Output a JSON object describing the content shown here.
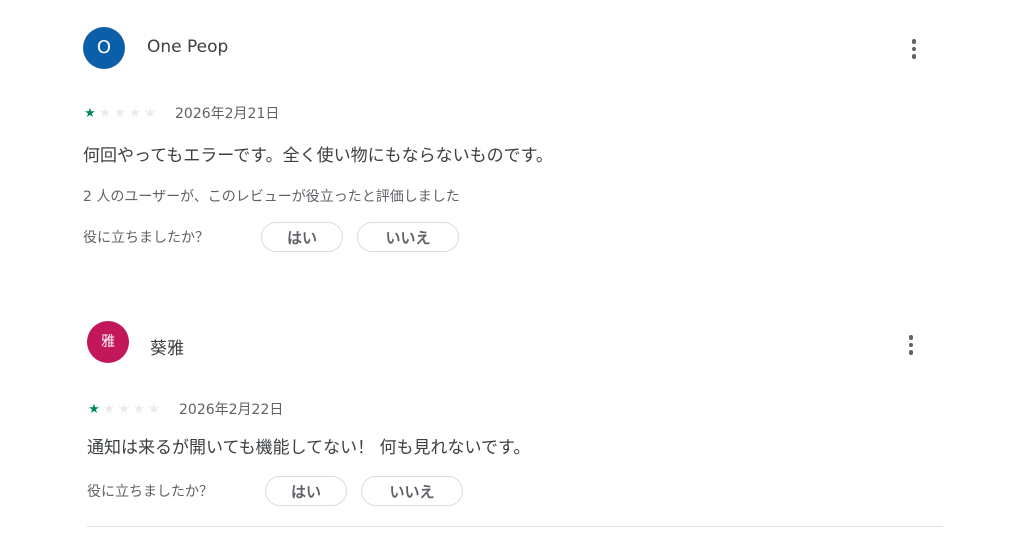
{
  "reviews": [
    {
      "avatar_letter": "O",
      "avatar_color": "#0b5ea8",
      "author": "One Peop",
      "rating": 1,
      "max_rating": 5,
      "date": "2026年2月21日",
      "text": "何回やってもエラーです。全く使い物にもならないものです。",
      "helpful_count": "2 人のユーザーが、このレビューが役立ったと評価しました",
      "helpful_question": "役に立ちましたか？",
      "yes_label": "はい",
      "no_label": "いいえ",
      "more_icon": "more-vert-icon"
    },
    {
      "avatar_letter": "雅",
      "avatar_color": "#c2185b",
      "author": "葵雅",
      "rating": 1,
      "max_rating": 5,
      "date": "2026年2月22日",
      "text": "通知は来るが開いても機能してない！ 何も見れないです。",
      "helpful_question": "役に立ちましたか？",
      "yes_label": "はい",
      "no_label": "いいえ",
      "more_icon": "more-vert-icon"
    }
  ],
  "colors": {
    "star_filled": "#01875f",
    "star_empty": "#e8eaed"
  }
}
